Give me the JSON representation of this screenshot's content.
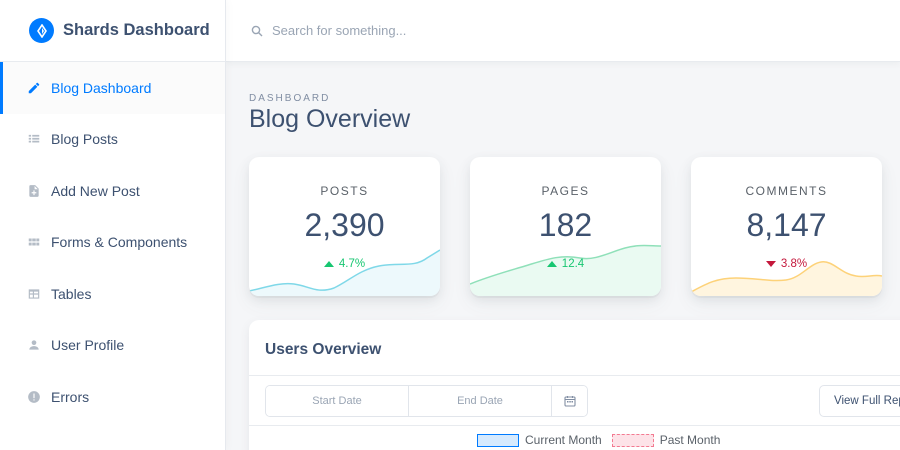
{
  "brand": {
    "name": "Shards Dashboard",
    "accent": "#007bff"
  },
  "sidebar": {
    "items": [
      {
        "label": "Blog Dashboard",
        "icon": "pencil-icon",
        "active": true
      },
      {
        "label": "Blog Posts",
        "icon": "list-icon"
      },
      {
        "label": "Add New Post",
        "icon": "note-add-icon"
      },
      {
        "label": "Forms & Components",
        "icon": "view-module-icon"
      },
      {
        "label": "Tables",
        "icon": "table-icon"
      },
      {
        "label": "User Profile",
        "icon": "person-icon"
      },
      {
        "label": "Errors",
        "icon": "error-icon"
      }
    ]
  },
  "search": {
    "placeholder": "Search for something..."
  },
  "page": {
    "subtitle": "DASHBOARD",
    "title": "Blog Overview"
  },
  "stats": [
    {
      "label": "POSTS",
      "value": "2,390",
      "change": "4.7%",
      "trend": "up",
      "color": "#00b8d8"
    },
    {
      "label": "PAGES",
      "value": "182",
      "change": "12.4",
      "trend": "up",
      "color": "#17c671"
    },
    {
      "label": "COMMENTS",
      "value": "8,147",
      "change": "3.8%",
      "trend": "down",
      "color": "#ffb400"
    }
  ],
  "users_overview": {
    "title": "Users Overview",
    "start_date_placeholder": "Start Date",
    "end_date_placeholder": "End Date",
    "report_button": "View Full Report",
    "legend": {
      "current": "Current Month",
      "past": "Past Month"
    }
  },
  "colors": {
    "up": "#17c671",
    "down": "#c4183c",
    "text": "#3d5170"
  }
}
